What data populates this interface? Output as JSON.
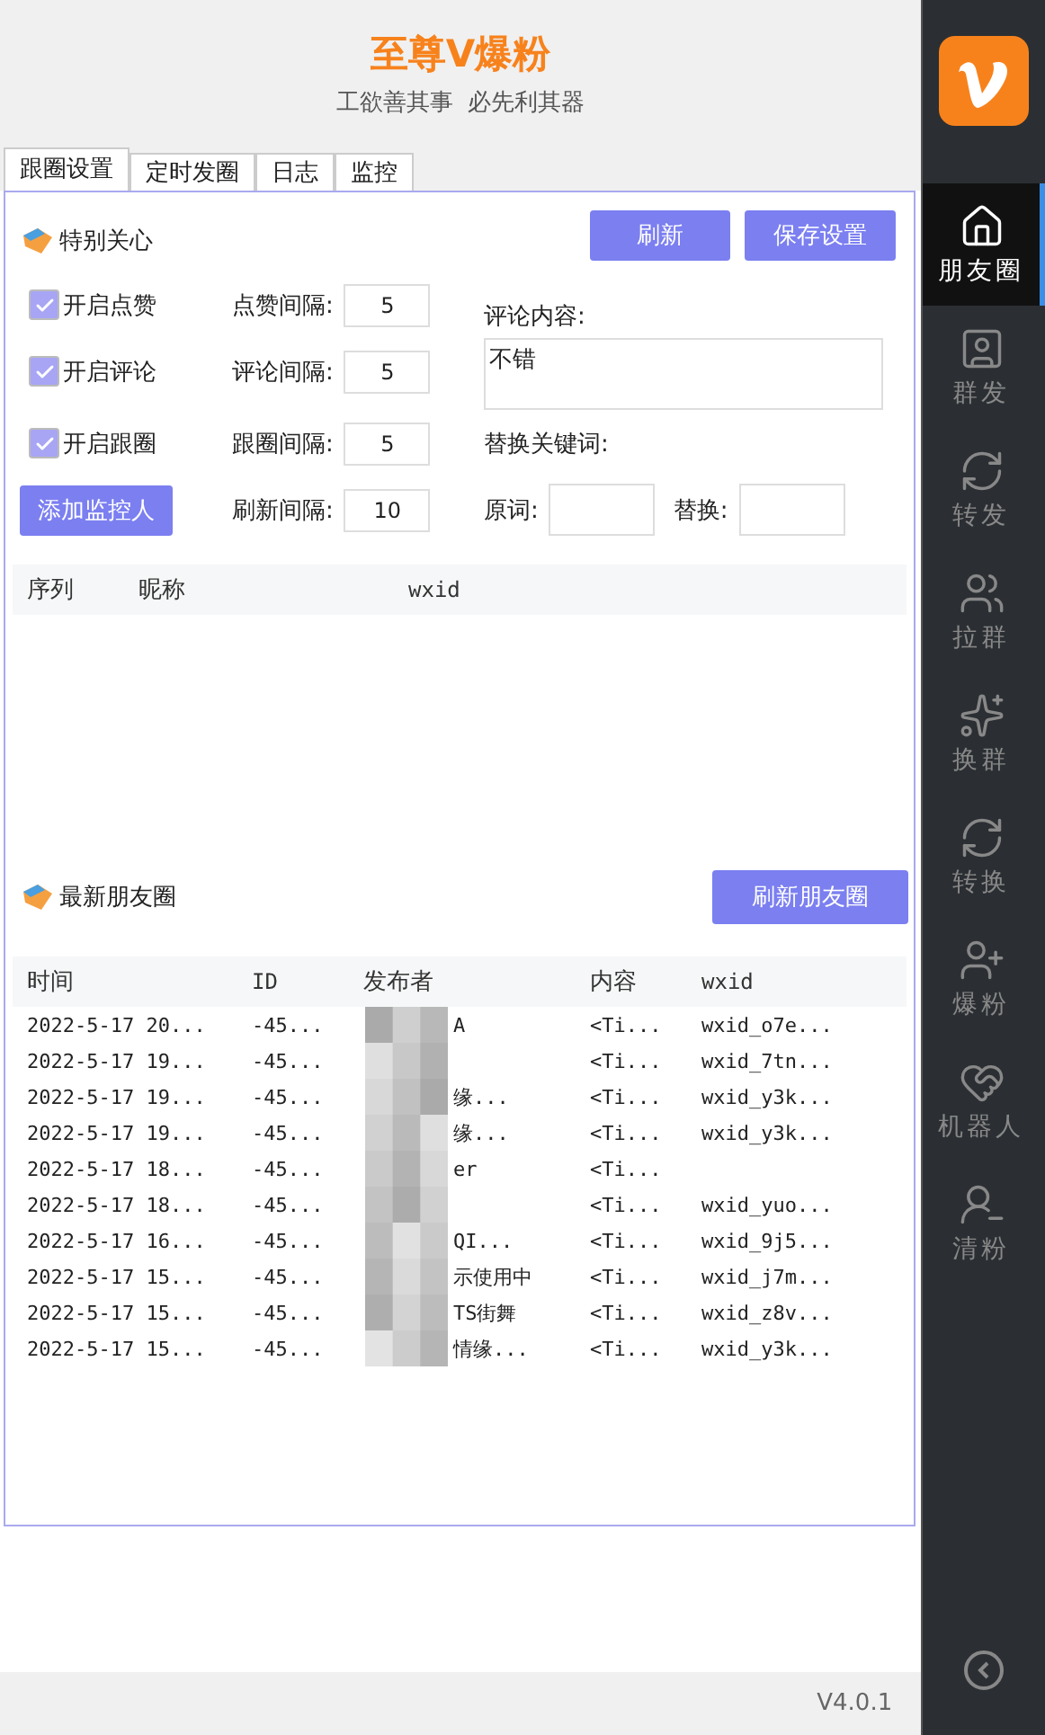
{
  "header": {
    "title": "至尊V爆粉",
    "slogan": "工欲善其事  必先利其器"
  },
  "tabs": [
    {
      "label": "跟圈设置",
      "selected": true
    },
    {
      "label": "定时发圈",
      "selected": false
    },
    {
      "label": "日志",
      "selected": false
    },
    {
      "label": "监控",
      "selected": false
    }
  ],
  "special": {
    "title": "特别关心",
    "buttons": [
      "刷新",
      "保存设置"
    ],
    "options": [
      {
        "label": "开启点赞",
        "checked": true,
        "interval_label": "点赞间隔:",
        "interval": "5"
      },
      {
        "label": "开启评论",
        "checked": true,
        "interval_label": "评论间隔:",
        "interval": "5"
      },
      {
        "label": "开启跟圈",
        "checked": true,
        "interval_label": "跟圈间隔:",
        "interval": "5"
      }
    ],
    "add_button": "添加监控人",
    "refresh_label": "刷新间隔:",
    "refresh_interval": "10",
    "comment_label": "评论内容:",
    "comment": "不错",
    "replace_label": "替换关键词:",
    "original_label": "原词:",
    "replace_with_label": "替换:"
  },
  "monitor_table": {
    "columns": [
      "序列",
      "昵称",
      "wxid"
    ]
  },
  "latest": {
    "title": "最新朋友圈",
    "button": "刷新朋友圈",
    "columns": [
      "时间",
      "ID",
      "发布者",
      "内容",
      "wxid"
    ],
    "rows": [
      [
        "2022-5-17 20...",
        "-45...",
        "A",
        "<Ti...",
        "wxid_o7e..."
      ],
      [
        "2022-5-17 19...",
        "-45...",
        "",
        "<Ti...",
        "wxid_7tn..."
      ],
      [
        "2022-5-17 19...",
        "-45...",
        "缘...",
        "<Ti...",
        "wxid_y3k..."
      ],
      [
        "2022-5-17 19...",
        "-45...",
        "缘...",
        "<Ti...",
        "wxid_y3k..."
      ],
      [
        "2022-5-17 18...",
        "-45...",
        "er",
        "<Ti...",
        ""
      ],
      [
        "2022-5-17 18...",
        "-45...",
        "",
        "<Ti...",
        "wxid_yuo..."
      ],
      [
        "2022-5-17 16...",
        "-45...",
        "QI...",
        "<Ti...",
        "wxid_9j5..."
      ],
      [
        "2022-5-17 15...",
        "-45...",
        "示使用中",
        "<Ti...",
        "wxid_j7m..."
      ],
      [
        "2022-5-17 15...",
        "-45...",
        "TS街舞",
        "<Ti...",
        "wxid_z8v..."
      ],
      [
        "2022-5-17 15...",
        "-45...",
        "情缘...",
        "<Ti...",
        "wxid_y3k..."
      ]
    ]
  },
  "version": "V4.0.1",
  "nav": [
    {
      "label": "朋友圈",
      "selected": true
    },
    {
      "label": "群发",
      "selected": false
    },
    {
      "label": "转发",
      "selected": false
    },
    {
      "label": "拉群",
      "selected": false
    },
    {
      "label": "换群",
      "selected": false
    },
    {
      "label": "转换",
      "selected": false
    },
    {
      "label": "爆粉",
      "selected": false
    },
    {
      "label": "机器人",
      "selected": false
    },
    {
      "label": "清粉",
      "selected": false
    }
  ]
}
